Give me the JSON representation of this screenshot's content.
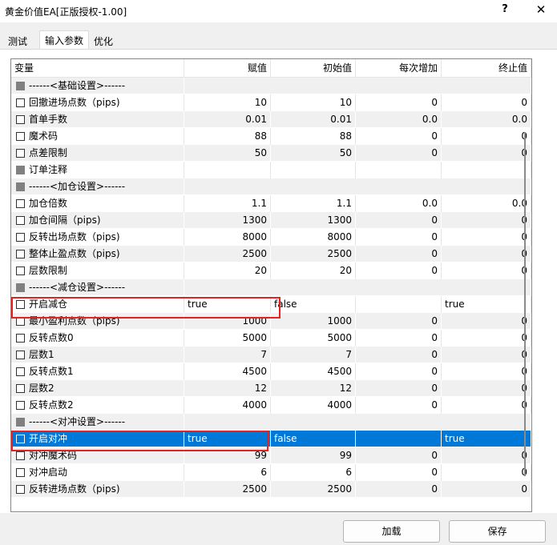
{
  "window": {
    "title": "黄金价值EA[正版授权-1.00]",
    "help": "?",
    "close": "✕"
  },
  "tabs": [
    {
      "label": "测试"
    },
    {
      "label": "输入参数"
    },
    {
      "label": "优化"
    }
  ],
  "columns": {
    "var": "变量",
    "value": "赋值",
    "start": "初始值",
    "step": "每次增加",
    "stop": "终止值"
  },
  "rows": [
    {
      "name": "------<基础设置>------",
      "type": "section"
    },
    {
      "name": "回撤进场点数（pips)",
      "value": "10",
      "start": "10",
      "step": "0",
      "stop": "0"
    },
    {
      "name": "首单手数",
      "value": "0.01",
      "start": "0.01",
      "step": "0.0",
      "stop": "0.0"
    },
    {
      "name": "魔术码",
      "value": "88",
      "start": "88",
      "step": "0",
      "stop": "0"
    },
    {
      "name": "点差限制",
      "value": "50",
      "start": "50",
      "step": "0",
      "stop": "0"
    },
    {
      "name": "订单注释",
      "value": "",
      "start": "",
      "step": "",
      "stop": "",
      "type": "string"
    },
    {
      "name": "------<加仓设置>------",
      "type": "section"
    },
    {
      "name": "加仓倍数",
      "value": "1.1",
      "start": "1.1",
      "step": "0.0",
      "stop": "0.0"
    },
    {
      "name": "加仓间隔（pips)",
      "value": "1300",
      "start": "1300",
      "step": "0",
      "stop": "0"
    },
    {
      "name": "反转出场点数（pips)",
      "value": "8000",
      "start": "8000",
      "step": "0",
      "stop": "0"
    },
    {
      "name": "整体止盈点数（pips)",
      "value": "2500",
      "start": "2500",
      "step": "0",
      "stop": "0"
    },
    {
      "name": "层数限制",
      "value": "20",
      "start": "20",
      "step": "0",
      "stop": "0"
    },
    {
      "name": "------<减仓设置>------",
      "type": "section"
    },
    {
      "name": "开启减仓",
      "value": "true",
      "start": "false",
      "step": "",
      "stop": "true",
      "type": "bool"
    },
    {
      "name": "最小盈利点数（pips)",
      "value": "1000",
      "start": "1000",
      "step": "0",
      "stop": "0"
    },
    {
      "name": "反转点数0",
      "value": "5000",
      "start": "5000",
      "step": "0",
      "stop": "0"
    },
    {
      "name": "层数1",
      "value": "7",
      "start": "7",
      "step": "0",
      "stop": "0"
    },
    {
      "name": "反转点数1",
      "value": "4500",
      "start": "4500",
      "step": "0",
      "stop": "0"
    },
    {
      "name": "层数2",
      "value": "12",
      "start": "12",
      "step": "0",
      "stop": "0"
    },
    {
      "name": "反转点数2",
      "value": "4000",
      "start": "4000",
      "step": "0",
      "stop": "0"
    },
    {
      "name": "------<对冲设置>------",
      "type": "section"
    },
    {
      "name": "开启对冲",
      "value": "true",
      "start": "false",
      "step": "",
      "stop": "true",
      "type": "bool",
      "selected": true
    },
    {
      "name": "对冲魔术码",
      "value": "99",
      "start": "99",
      "step": "0",
      "stop": "0"
    },
    {
      "name": "对冲启动",
      "value": "6",
      "start": "6",
      "step": "0",
      "stop": "0"
    },
    {
      "name": "反转进场点数（pips)",
      "value": "2500",
      "start": "2500",
      "step": "0",
      "stop": "0"
    }
  ],
  "buttons": {
    "load": "加载",
    "save": "保存"
  },
  "colors": {
    "selection": "#0078d7",
    "highlight": "#e8201f"
  }
}
